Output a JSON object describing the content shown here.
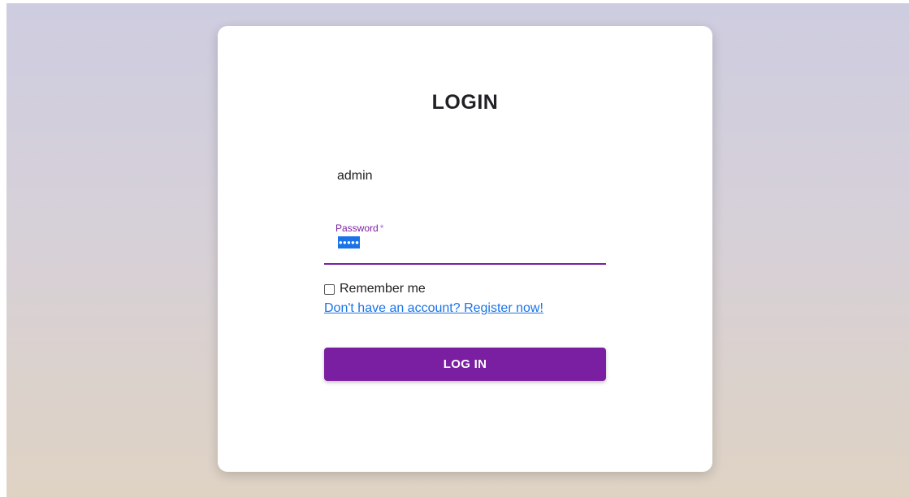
{
  "login": {
    "title": "LOGIN",
    "username": {
      "value": "admin"
    },
    "password": {
      "label": "Password",
      "required_marker": "*",
      "value": "•••••"
    },
    "remember_me": {
      "label": "Remember me",
      "checked": false
    },
    "register_link": "Don't have an account? Register now!",
    "submit_label": "LOG IN"
  },
  "colors": {
    "accent": "#7b1fa2",
    "link": "#1a73e8",
    "text_selection": "#1a73e8",
    "background_top": "#cecde0",
    "background_bottom": "#dfd3c4"
  },
  "icons": {
    "remember_checkbox": "checkbox-unchecked-icon"
  }
}
